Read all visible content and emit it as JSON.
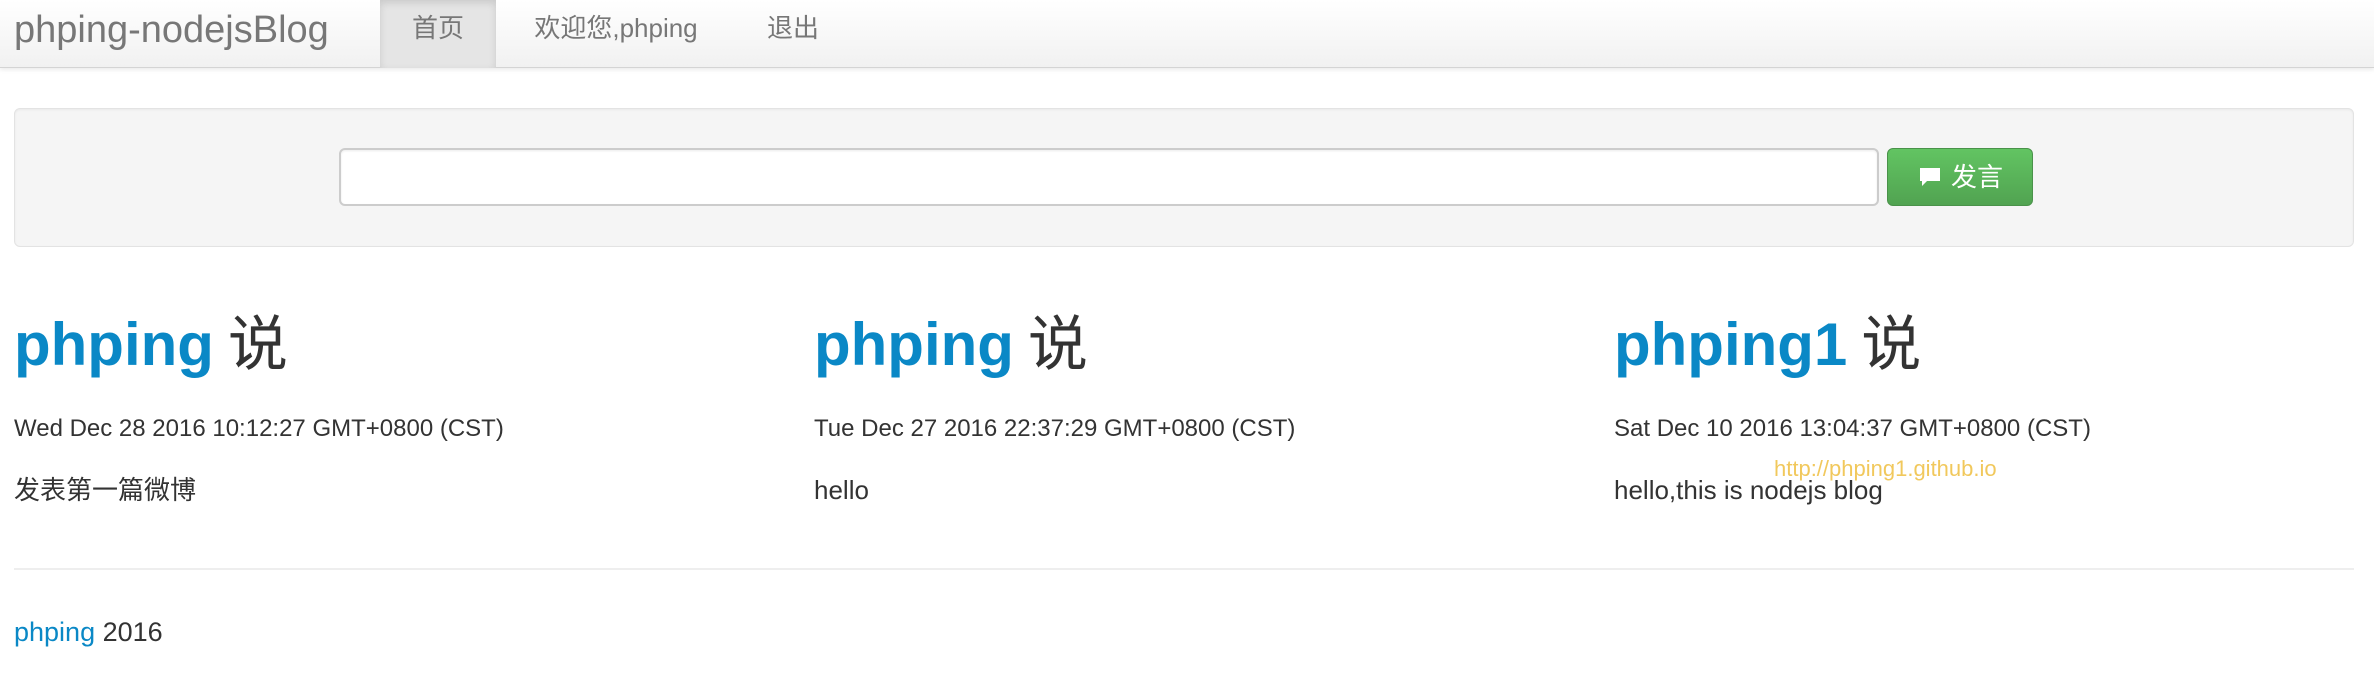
{
  "navbar": {
    "brand": "phping-nodejsBlog",
    "items": [
      {
        "label": "首页",
        "active": true
      },
      {
        "label": "欢迎您,phping",
        "active": false
      },
      {
        "label": "退出",
        "active": false
      }
    ]
  },
  "post_form": {
    "input_value": "",
    "input_placeholder": "",
    "button_icon": "comment-icon",
    "button_label": "发言"
  },
  "posts": [
    {
      "author": "phping",
      "says": "说",
      "time": "Wed Dec 28 2016 10:12:27 GMT+0800 (CST)",
      "content": "发表第一篇微博"
    },
    {
      "author": "phping",
      "says": "说",
      "time": "Tue Dec 27 2016 22:37:29 GMT+0800 (CST)",
      "content": "hello"
    },
    {
      "author": "phping1",
      "says": "说",
      "time": "Sat Dec 10 2016 13:04:37 GMT+0800 (CST)",
      "content": "hello,this is nodejs blog"
    }
  ],
  "watermark": "http://phping1.github.io",
  "footer": {
    "link": "phping",
    "year": "2016"
  },
  "colors": {
    "link": "#0a88c6",
    "button_green": "#5bb75b",
    "watermark": "#f0c34b"
  }
}
